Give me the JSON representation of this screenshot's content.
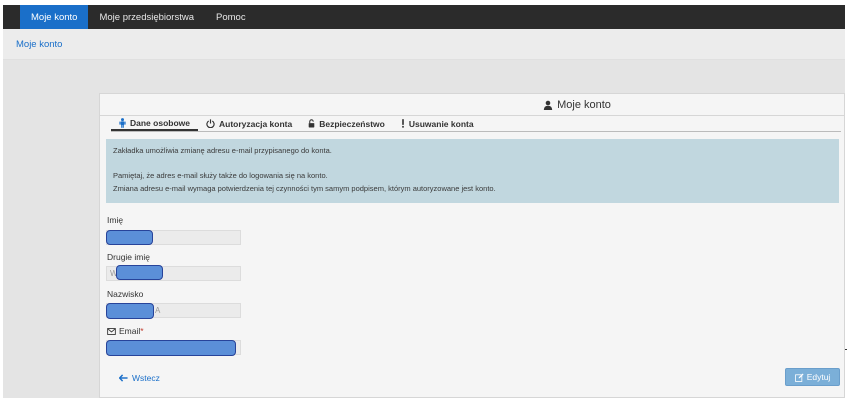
{
  "nav": {
    "items": [
      {
        "label": "Moje konto",
        "active": true
      },
      {
        "label": "Moje przedsiębiorstwa",
        "active": false
      },
      {
        "label": "Pomoc",
        "active": false
      }
    ]
  },
  "breadcrumb": {
    "label": "Moje konto"
  },
  "panel": {
    "title": "Moje konto",
    "title_icon": "user-icon",
    "tabs": [
      {
        "label": "Dane osobowe",
        "icon": "person-icon",
        "active": true
      },
      {
        "label": "Autoryzacja konta",
        "icon": "power-icon",
        "active": false
      },
      {
        "label": "Bezpieczeństwo",
        "icon": "lock-icon",
        "active": false
      },
      {
        "label": "Usuwanie konta",
        "icon": "exclamation-icon",
        "active": false
      }
    ],
    "info": {
      "line1": "Zakładka umożliwia zmianę adresu e-mail przypisanego do konta.",
      "line2": "Pamiętaj, że adres e-mail służy także do logowania się na konto.",
      "line3": "Zmiana adresu e-mail wymaga potwierdzenia tej czynności tym samym podpisem, którym autoryzowane jest konto."
    },
    "form": {
      "first_name": {
        "label": "Imię",
        "value": ""
      },
      "middle_name": {
        "label": "Drugie imię",
        "value": "W"
      },
      "last_name": {
        "label": "Nazwisko",
        "value": "A"
      },
      "email": {
        "label": "Email",
        "required_mark": "*",
        "icon": "envelope-icon",
        "value": ""
      }
    },
    "back_label": "Wstecz",
    "edit_label": "Edytuj"
  },
  "colors": {
    "nav_bg": "#2b2b2b",
    "accent": "#1a6fc9",
    "info_bg": "#c1d7df",
    "edit_button_bg": "#7bafd8",
    "required": "#c0392b"
  }
}
